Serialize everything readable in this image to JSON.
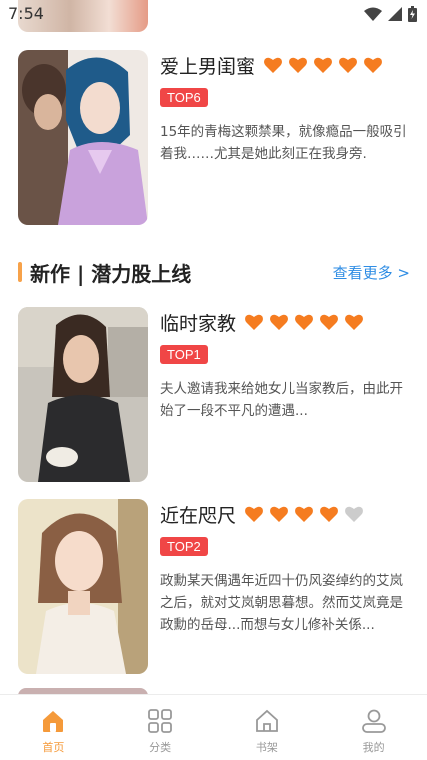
{
  "status_bar": {
    "time": "7:54"
  },
  "books": [
    {
      "title": "爱上男闺蜜",
      "rating": 5,
      "max_rating": 5,
      "badge": "TOP6",
      "description": "15年的青梅这颗禁果，就像瘾品一般吸引着我……尤其是她此刻正在我身旁."
    }
  ],
  "section": {
    "title": "新作 | 潜力股上线",
    "more": "查看更多 >"
  },
  "section_books": [
    {
      "title": "临时家教",
      "rating": 5,
      "max_rating": 5,
      "badge": "TOP1",
      "description": "夫人邀请我来给她女儿当家教后，由此开始了一段不平凡的遭遇..."
    },
    {
      "title": "近在咫尺",
      "rating": 4,
      "max_rating": 5,
      "badge": "TOP2",
      "description": "政勳某天偶遇年近四十仍风姿绰约的艾岚之后，就对艾岚朝思暮想。然而艾岚竟是政勳的岳母...而想与女儿修补关係..."
    }
  ],
  "tabbar": [
    {
      "label": "首页",
      "icon": "home-icon",
      "active": true
    },
    {
      "label": "分类",
      "icon": "category-grid-icon",
      "active": false
    },
    {
      "label": "书架",
      "icon": "bookshelf-icon",
      "active": false
    },
    {
      "label": "我的",
      "icon": "profile-icon",
      "active": false
    }
  ],
  "colors": {
    "accent": "#f59a3a",
    "heart_on": "#f57c20",
    "heart_off": "#cccccc",
    "badge": "#f04646",
    "link": "#2f8de4"
  }
}
